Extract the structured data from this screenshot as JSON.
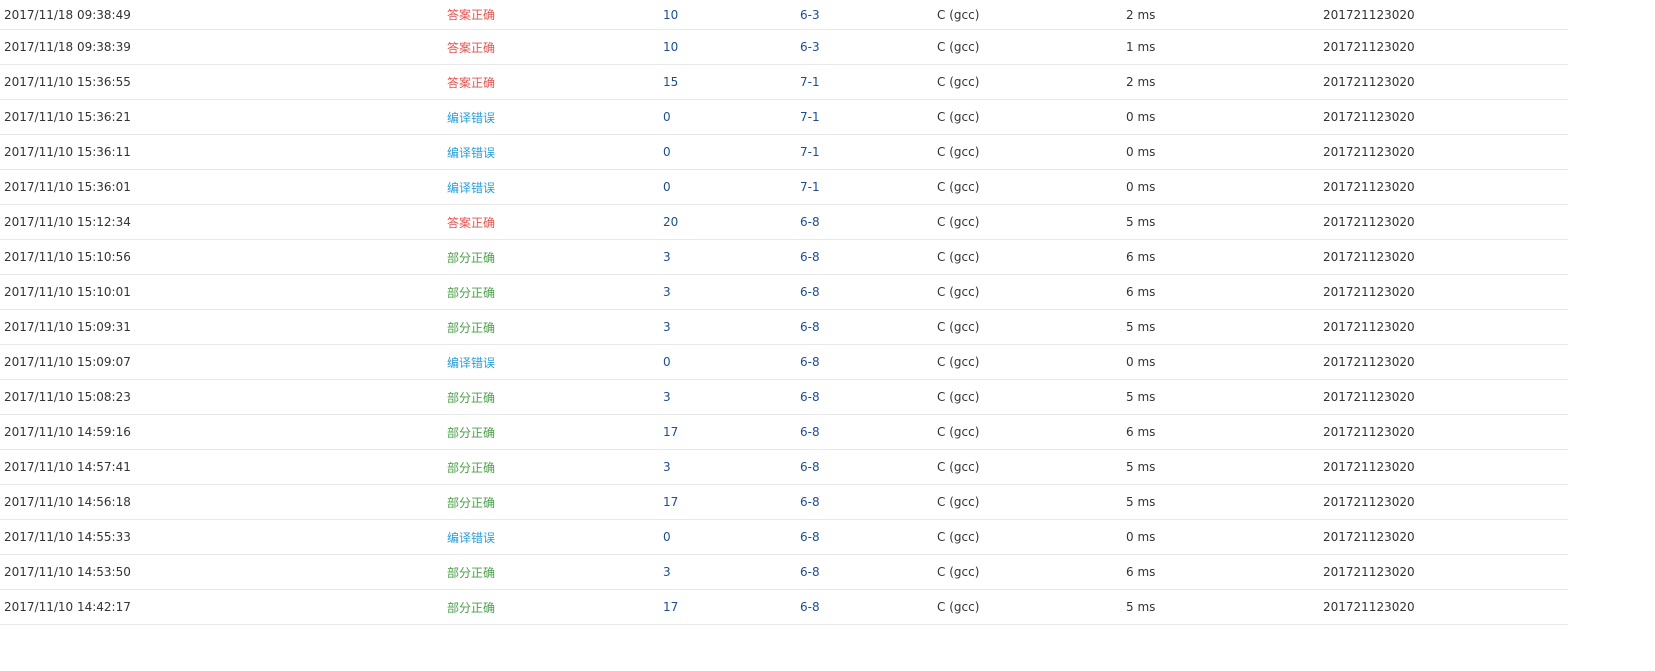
{
  "status_colors": {
    "accepted": "#e3524f",
    "compile_error": "#2a9fd6",
    "partial": "#4aa04a"
  },
  "rows": [
    {
      "time": "2017/11/18 09:38:49",
      "status": "答案正确",
      "status_type": "accepted",
      "score": "10",
      "problem": "6-3",
      "language": "C (gcc)",
      "duration": "2 ms",
      "user": "201721123020"
    },
    {
      "time": "2017/11/18 09:38:39",
      "status": "答案正确",
      "status_type": "accepted",
      "score": "10",
      "problem": "6-3",
      "language": "C (gcc)",
      "duration": "1 ms",
      "user": "201721123020"
    },
    {
      "time": "2017/11/10 15:36:55",
      "status": "答案正确",
      "status_type": "accepted",
      "score": "15",
      "problem": "7-1",
      "language": "C (gcc)",
      "duration": "2 ms",
      "user": "201721123020"
    },
    {
      "time": "2017/11/10 15:36:21",
      "status": "编译错误",
      "status_type": "compile_error",
      "score": "0",
      "problem": "7-1",
      "language": "C (gcc)",
      "duration": "0 ms",
      "user": "201721123020"
    },
    {
      "time": "2017/11/10 15:36:11",
      "status": "编译错误",
      "status_type": "compile_error",
      "score": "0",
      "problem": "7-1",
      "language": "C (gcc)",
      "duration": "0 ms",
      "user": "201721123020"
    },
    {
      "time": "2017/11/10 15:36:01",
      "status": "编译错误",
      "status_type": "compile_error",
      "score": "0",
      "problem": "7-1",
      "language": "C (gcc)",
      "duration": "0 ms",
      "user": "201721123020"
    },
    {
      "time": "2017/11/10 15:12:34",
      "status": "答案正确",
      "status_type": "accepted",
      "score": "20",
      "problem": "6-8",
      "language": "C (gcc)",
      "duration": "5 ms",
      "user": "201721123020"
    },
    {
      "time": "2017/11/10 15:10:56",
      "status": "部分正确",
      "status_type": "partial",
      "score": "3",
      "problem": "6-8",
      "language": "C (gcc)",
      "duration": "6 ms",
      "user": "201721123020"
    },
    {
      "time": "2017/11/10 15:10:01",
      "status": "部分正确",
      "status_type": "partial",
      "score": "3",
      "problem": "6-8",
      "language": "C (gcc)",
      "duration": "6 ms",
      "user": "201721123020"
    },
    {
      "time": "2017/11/10 15:09:31",
      "status": "部分正确",
      "status_type": "partial",
      "score": "3",
      "problem": "6-8",
      "language": "C (gcc)",
      "duration": "5 ms",
      "user": "201721123020"
    },
    {
      "time": "2017/11/10 15:09:07",
      "status": "编译错误",
      "status_type": "compile_error",
      "score": "0",
      "problem": "6-8",
      "language": "C (gcc)",
      "duration": "0 ms",
      "user": "201721123020"
    },
    {
      "time": "2017/11/10 15:08:23",
      "status": "部分正确",
      "status_type": "partial",
      "score": "3",
      "problem": "6-8",
      "language": "C (gcc)",
      "duration": "5 ms",
      "user": "201721123020"
    },
    {
      "time": "2017/11/10 14:59:16",
      "status": "部分正确",
      "status_type": "partial",
      "score": "17",
      "problem": "6-8",
      "language": "C (gcc)",
      "duration": "6 ms",
      "user": "201721123020"
    },
    {
      "time": "2017/11/10 14:57:41",
      "status": "部分正确",
      "status_type": "partial",
      "score": "3",
      "problem": "6-8",
      "language": "C (gcc)",
      "duration": "5 ms",
      "user": "201721123020"
    },
    {
      "time": "2017/11/10 14:56:18",
      "status": "部分正确",
      "status_type": "partial",
      "score": "17",
      "problem": "6-8",
      "language": "C (gcc)",
      "duration": "5 ms",
      "user": "201721123020"
    },
    {
      "time": "2017/11/10 14:55:33",
      "status": "编译错误",
      "status_type": "compile_error",
      "score": "0",
      "problem": "6-8",
      "language": "C (gcc)",
      "duration": "0 ms",
      "user": "201721123020"
    },
    {
      "time": "2017/11/10 14:53:50",
      "status": "部分正确",
      "status_type": "partial",
      "score": "3",
      "problem": "6-8",
      "language": "C (gcc)",
      "duration": "6 ms",
      "user": "201721123020"
    },
    {
      "time": "2017/11/10 14:42:17",
      "status": "部分正确",
      "status_type": "partial",
      "score": "17",
      "problem": "6-8",
      "language": "C (gcc)",
      "duration": "5 ms",
      "user": "201721123020"
    }
  ]
}
